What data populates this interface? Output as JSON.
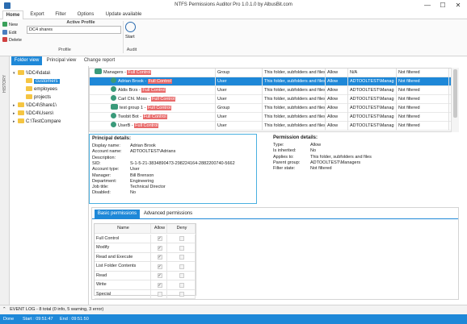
{
  "window": {
    "title": "NTFS Permissions Auditor Pro 1.0.1.0 by AlbusBit.com",
    "minimize": "—",
    "maximize": "☐",
    "close": "✕"
  },
  "menu": [
    "Home",
    "Export",
    "Filter",
    "Options",
    "Update available"
  ],
  "ribbon": {
    "new_label": "New",
    "edit_label": "Edit",
    "delete_label": "Delete",
    "active_profile_label": "Active Profile",
    "profile_value": "DC4 shares",
    "start_label": "Start",
    "profile_group": "Profile",
    "audit_group": "Audit"
  },
  "history_label": "HISTORY",
  "views": [
    "Folder view",
    "Principal view",
    "Change report"
  ],
  "tree": [
    {
      "label": "\\\\DC4\\data\\",
      "level": 0,
      "expanded": true
    },
    {
      "label": "customers",
      "level": 1,
      "selected": true
    },
    {
      "label": "employees",
      "level": 1
    },
    {
      "label": "projects",
      "level": 1
    },
    {
      "label": "\\\\DC4\\Share1\\",
      "level": 0
    },
    {
      "label": "\\\\DC4\\Users\\",
      "level": 0
    },
    {
      "label": "C:\\TestCompare",
      "level": 0
    }
  ],
  "grid_rows": [
    {
      "name": "Managers - ",
      "fc": "Full Control",
      "type": "Group",
      "applies": "This folder, subfolders and files",
      "access": "Allow",
      "inherited": "N/A",
      "source": "N/A",
      "filter": "Not filtered",
      "icon": "group",
      "indent": 0
    },
    {
      "name": "Adrian Brook - ",
      "fc": "Full Control",
      "type": "User",
      "applies": "This folder, subfolders and files",
      "access": "Allow",
      "inherited": "ADTOOLTEST\\Manag",
      "source": "",
      "filter": "Not filtered",
      "icon": "user",
      "indent": 1,
      "selected": true
    },
    {
      "name": "Aldis Brzs - ",
      "fc": "Full Control",
      "type": "User",
      "applies": "This folder, subfolders and files",
      "access": "Allow",
      "inherited": "ADTOOLTEST\\Manag",
      "source": "",
      "filter": "Not filtered",
      "icon": "user",
      "indent": 1
    },
    {
      "name": "Carl Chl. Moss - ",
      "fc": "Full Control",
      "type": "User",
      "applies": "This folder, subfolders and files",
      "access": "Allow",
      "inherited": "ADTOOLTEST\\Manag",
      "source": "",
      "filter": "Not filtered",
      "icon": "user",
      "indent": 1
    },
    {
      "name": "test group 1 - ",
      "fc": "Full Control",
      "type": "Group",
      "applies": "This folder, subfolders and files",
      "access": "Allow",
      "inherited": "ADTOOLTEST\\Manag",
      "source": "",
      "filter": "Not filtered",
      "icon": "group",
      "indent": 1
    },
    {
      "name": "Twobit Bot - ",
      "fc": "Full Control",
      "type": "User",
      "applies": "This folder, subfolders and files",
      "access": "Allow",
      "inherited": "ADTOOLTEST\\Manag",
      "source": "",
      "filter": "Not filtered",
      "icon": "user",
      "indent": 1
    },
    {
      "name": "UserB - ",
      "fc": "Full Control",
      "type": "User",
      "applies": "This folder, subfolders and files",
      "access": "Allow",
      "inherited": "ADTOOLTEST\\Manag",
      "source": "",
      "filter": "Not filtered",
      "icon": "user",
      "indent": 1
    }
  ],
  "principal": {
    "heading": "Principal details:",
    "fields": [
      [
        "Display name:",
        "Adrian Brook"
      ],
      [
        "Account name:",
        "ADTOOLTEST\\Adrians"
      ],
      [
        "Description:",
        ""
      ],
      [
        "SID:",
        "S-1-5-21-3834890473-298224164-2882200740-5662"
      ],
      [
        "Account type:",
        "User"
      ],
      [
        "Manager:",
        "Bill Brenson"
      ],
      [
        "Department:",
        "Engineering"
      ],
      [
        "Job title:",
        "Technical Director"
      ],
      [
        "Disabled:",
        "No"
      ]
    ]
  },
  "permission": {
    "heading": "Permission details:",
    "fields": [
      [
        "Type:",
        "Allow"
      ],
      [
        "Is inherited:",
        "No"
      ],
      [
        "Applies to:",
        "This folder, subfolders and files"
      ],
      [
        "Parent group:",
        "ADTOOLTEST\\Managers"
      ],
      [
        "Filter state:",
        "Not filtered"
      ]
    ]
  },
  "perm_tabs": [
    "Basic permissions",
    "Advanced permissions"
  ],
  "perm_table": {
    "headers": [
      "Name",
      "Allow",
      "Deny"
    ],
    "rows": [
      {
        "name": "Full Control",
        "allow": true,
        "deny": false
      },
      {
        "name": "Modify",
        "allow": true,
        "deny": false
      },
      {
        "name": "Read and Execute",
        "allow": true,
        "deny": false
      },
      {
        "name": "List Folder Contents",
        "allow": true,
        "deny": false
      },
      {
        "name": "Read",
        "allow": true,
        "deny": false
      },
      {
        "name": "Write",
        "allow": true,
        "deny": false
      },
      {
        "name": "Special",
        "allow": false,
        "deny": false
      }
    ]
  },
  "event_log": "EVENT LOG - 8 total (0 info, 5 warning, 3 error)",
  "status": {
    "state": "Done",
    "start": "Start : 09:51:47",
    "end": "End : 09:51:50"
  },
  "colors": {
    "accent": "#1e88d8",
    "full_control": "#e86a6a"
  }
}
